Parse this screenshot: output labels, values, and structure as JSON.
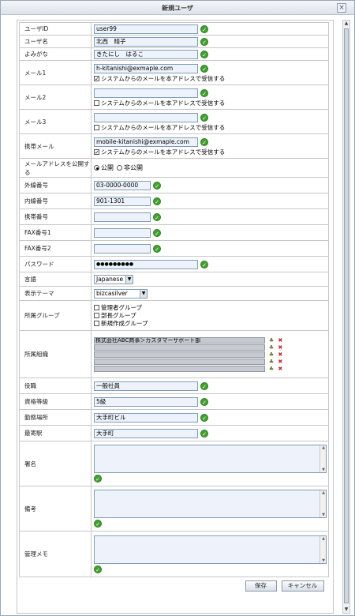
{
  "window": {
    "title": "新規ユーザ",
    "close_label": "×"
  },
  "fields": {
    "user_id": {
      "label": "ユーザID",
      "value": "user99"
    },
    "user_name": {
      "label": "ユーザ名",
      "value": "北西　晴子"
    },
    "reading": {
      "label": "よみがな",
      "value": "きたにし　はるこ"
    },
    "mail1": {
      "label": "メール1",
      "value": "h-kitanishi@exmaple.com",
      "option": "システムからのメールを本アドレスで受信する",
      "checked": true
    },
    "mail2": {
      "label": "メール2",
      "value": "",
      "option": "システムからのメールを本アドレスで受信する",
      "checked": false
    },
    "mail3": {
      "label": "メール3",
      "value": "",
      "option": "システムからのメールを本アドレスで受信する",
      "checked": false
    },
    "mobile_mail": {
      "label": "携帯メール",
      "value": "mobile-kitanishi@exmaple.com",
      "option": "システムからのメールを本アドレスで受信する",
      "checked": true
    },
    "publish": {
      "label": "メールアドレスを公開する",
      "public": "公開",
      "private": "非公開",
      "selected": "public"
    },
    "ext_phone": {
      "label": "外線番号",
      "value": "03-0000-0000"
    },
    "int_phone": {
      "label": "内線番号",
      "value": "901-1301"
    },
    "mobile_phone": {
      "label": "携帯番号",
      "value": ""
    },
    "fax1": {
      "label": "FAX番号1",
      "value": ""
    },
    "fax2": {
      "label": "FAX番号2",
      "value": ""
    },
    "password": {
      "label": "パスワード",
      "value": "●●●●●●●●●"
    },
    "language": {
      "label": "言語",
      "value": "Japanese"
    },
    "theme": {
      "label": "表示テーマ",
      "value": "bizcasilver"
    },
    "groups": {
      "label": "所属グループ",
      "items": [
        "管理者グループ",
        "部長グループ",
        "新規作成グループ"
      ]
    },
    "org": {
      "label": "所属組織",
      "items": [
        "株式会社ABC商事＞カスタマーサポート部",
        "",
        "",
        "",
        ""
      ]
    },
    "position": {
      "label": "役職",
      "value": "一般社員"
    },
    "qualification": {
      "label": "資格等級",
      "value": "5級"
    },
    "workplace": {
      "label": "勤務場所",
      "value": "大手町ビル"
    },
    "station": {
      "label": "最寄駅",
      "value": "大手町"
    },
    "signature": {
      "label": "署名",
      "value": ""
    },
    "remarks": {
      "label": "備考",
      "value": ""
    },
    "admin_memo": {
      "label": "管理メモ",
      "value": ""
    }
  },
  "buttons": {
    "save": "保存",
    "cancel": "キャンセル"
  },
  "icons": {
    "valid": "check-circle-icon",
    "tree": "tree-icon",
    "delete": "delete-icon"
  },
  "colors": {
    "valid": "#3ea32a",
    "input_bg": "#eef3fb",
    "border": "#c7c7c7"
  }
}
